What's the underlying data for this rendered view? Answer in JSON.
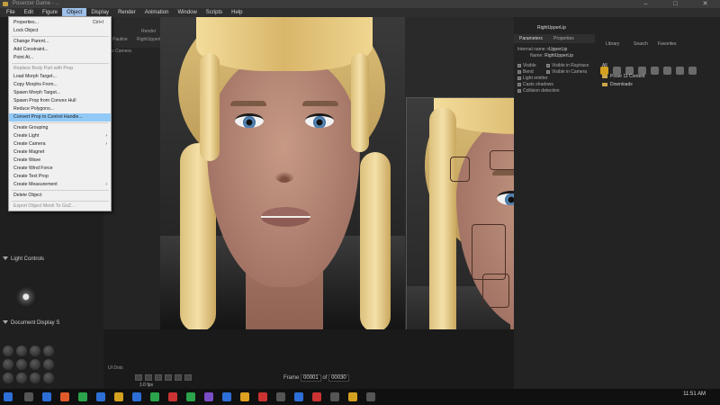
{
  "window": {
    "title": "Poserzer Game - ...",
    "controls": [
      "–",
      "□",
      "✕"
    ]
  },
  "menubar": [
    "File",
    "Edit",
    "Figure",
    "Object",
    "Display",
    "Render",
    "Animation",
    "Window",
    "Scripts",
    "Help"
  ],
  "menu_active": "Object",
  "object_menu": [
    {
      "label": "Properties...",
      "shortcut": "Ctrl+I"
    },
    {
      "label": "Lock Object"
    },
    {
      "sep": true
    },
    {
      "label": "Change Parent..."
    },
    {
      "label": "Add Constraint..."
    },
    {
      "label": "Point At..."
    },
    {
      "sep": true
    },
    {
      "label": "Replace Body Part with Prop",
      "disabled": true
    },
    {
      "label": "Load Morph Target..."
    },
    {
      "label": "Copy Morphs From..."
    },
    {
      "label": "Spawn Morph Target..."
    },
    {
      "label": "Spawn Prop from Convex Hull"
    },
    {
      "label": "Reduce Polygons..."
    },
    {
      "label": "Convert Prop to Control Handle...",
      "highlighted": true
    },
    {
      "sep": true
    },
    {
      "label": "Create Grouping"
    },
    {
      "label": "Create Light",
      "submenu": true
    },
    {
      "label": "Create Camera",
      "submenu": true
    },
    {
      "label": "Create Magnet"
    },
    {
      "label": "Create Wave"
    },
    {
      "label": "Create Wind Force"
    },
    {
      "label": "Create Text Prop"
    },
    {
      "label": "Create Measurement",
      "submenu": true
    },
    {
      "sep": true
    },
    {
      "label": "Delete Object"
    },
    {
      "sep": true
    },
    {
      "label": "Export Object Mesh To GoZ...",
      "disabled": true
    }
  ],
  "left_panel": {
    "light_controls": "Light Controls",
    "document_display": "Document Display S",
    "camera_label": "e Camera"
  },
  "strip": {
    "figure": "Pauline",
    "bodypart": "RightUpperLip",
    "render": "Render"
  },
  "right_panel": {
    "tabs": [
      "Parameters",
      "Properties"
    ],
    "internal_name_label": "Internal name:",
    "internal_name": "rUpperLip",
    "name_label": "Name:",
    "name": "RightUpperLip",
    "header": "RightUpperLip",
    "checkboxes": [
      "Visible",
      "Visible in Raytrace",
      "Bend",
      "Visible in Camera",
      "Light emitter",
      "Casts shadows",
      "Collision detection"
    ],
    "library_tabs": [
      "Library",
      "Search",
      "Favorites"
    ],
    "library_all": "All",
    "library_items": [
      "Poser 11 Content",
      "Downloads"
    ]
  },
  "timeline": {
    "frame_label": "Frame",
    "frame_value": "00001",
    "of": "of",
    "total": "00030",
    "rate": "1.0 fps",
    "ui_dots": "UI Dots"
  },
  "taskbar": {
    "time": "11:51 AM"
  }
}
